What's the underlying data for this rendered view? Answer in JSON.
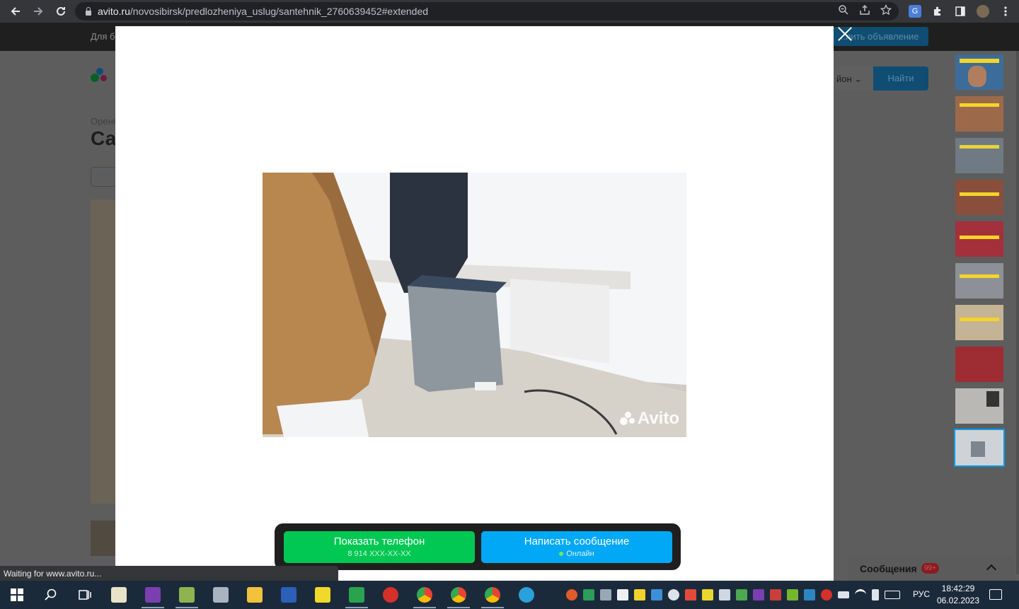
{
  "browser": {
    "url_host": "avito.ru",
    "url_path": "/novosibirsk/predlozheniya_uslug/santehnik_2760639452#extended"
  },
  "page_bg": {
    "topbar_text": "Для б",
    "post_ad_label": "...лить объявление",
    "breadcrumb": "Оренб",
    "title": "Са",
    "region_label": "йон",
    "find_label": "Найти"
  },
  "modal": {
    "watermark": "Avito",
    "phone_button": {
      "label": "Показать телефон",
      "number": "8 914 XXX-XX-XX"
    },
    "message_button": {
      "label": "Написать сообщение",
      "status": "Онлайн"
    }
  },
  "messages_widget": {
    "label": "Сообщения",
    "badge": "99+"
  },
  "status_bar": "Waiting for www.avito.ru...",
  "taskbar": {
    "language": "РУС",
    "time": "18:42:29",
    "date": "06.02.2023"
  },
  "colors": {
    "phone_button": "#00c853",
    "message_button": "#00a8f5",
    "taskbar": "#1b2a3a"
  }
}
